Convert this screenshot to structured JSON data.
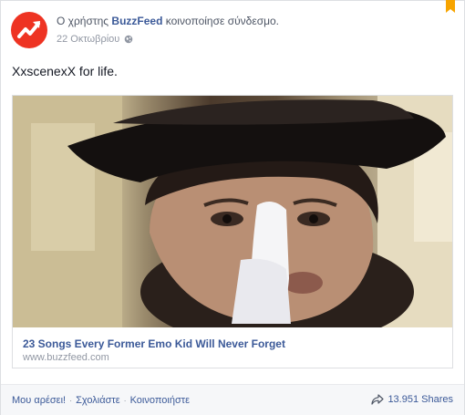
{
  "post": {
    "actor_prefix": "Ο χρήστης",
    "actor_name": "BuzzFeed",
    "action_text": "κοινοποίησε σύνδεσμο.",
    "date": "22 Οκτωβρίου",
    "privacy_icon": "globe-icon",
    "message": "XxscenexX for life."
  },
  "attachment": {
    "title": "23 Songs Every Former Emo Kid Will Never Forget",
    "domain": "www.buzzfeed.com"
  },
  "footer": {
    "like_label": "Μου αρέσει!",
    "comment_label": "Σχολιάστε",
    "share_label": "Κοινοποιήστε",
    "shares_count": "13.951 Shares"
  },
  "colors": {
    "brand_red": "#ee3322",
    "link_blue": "#3b5998",
    "bookmark_orange": "#f7a400"
  }
}
